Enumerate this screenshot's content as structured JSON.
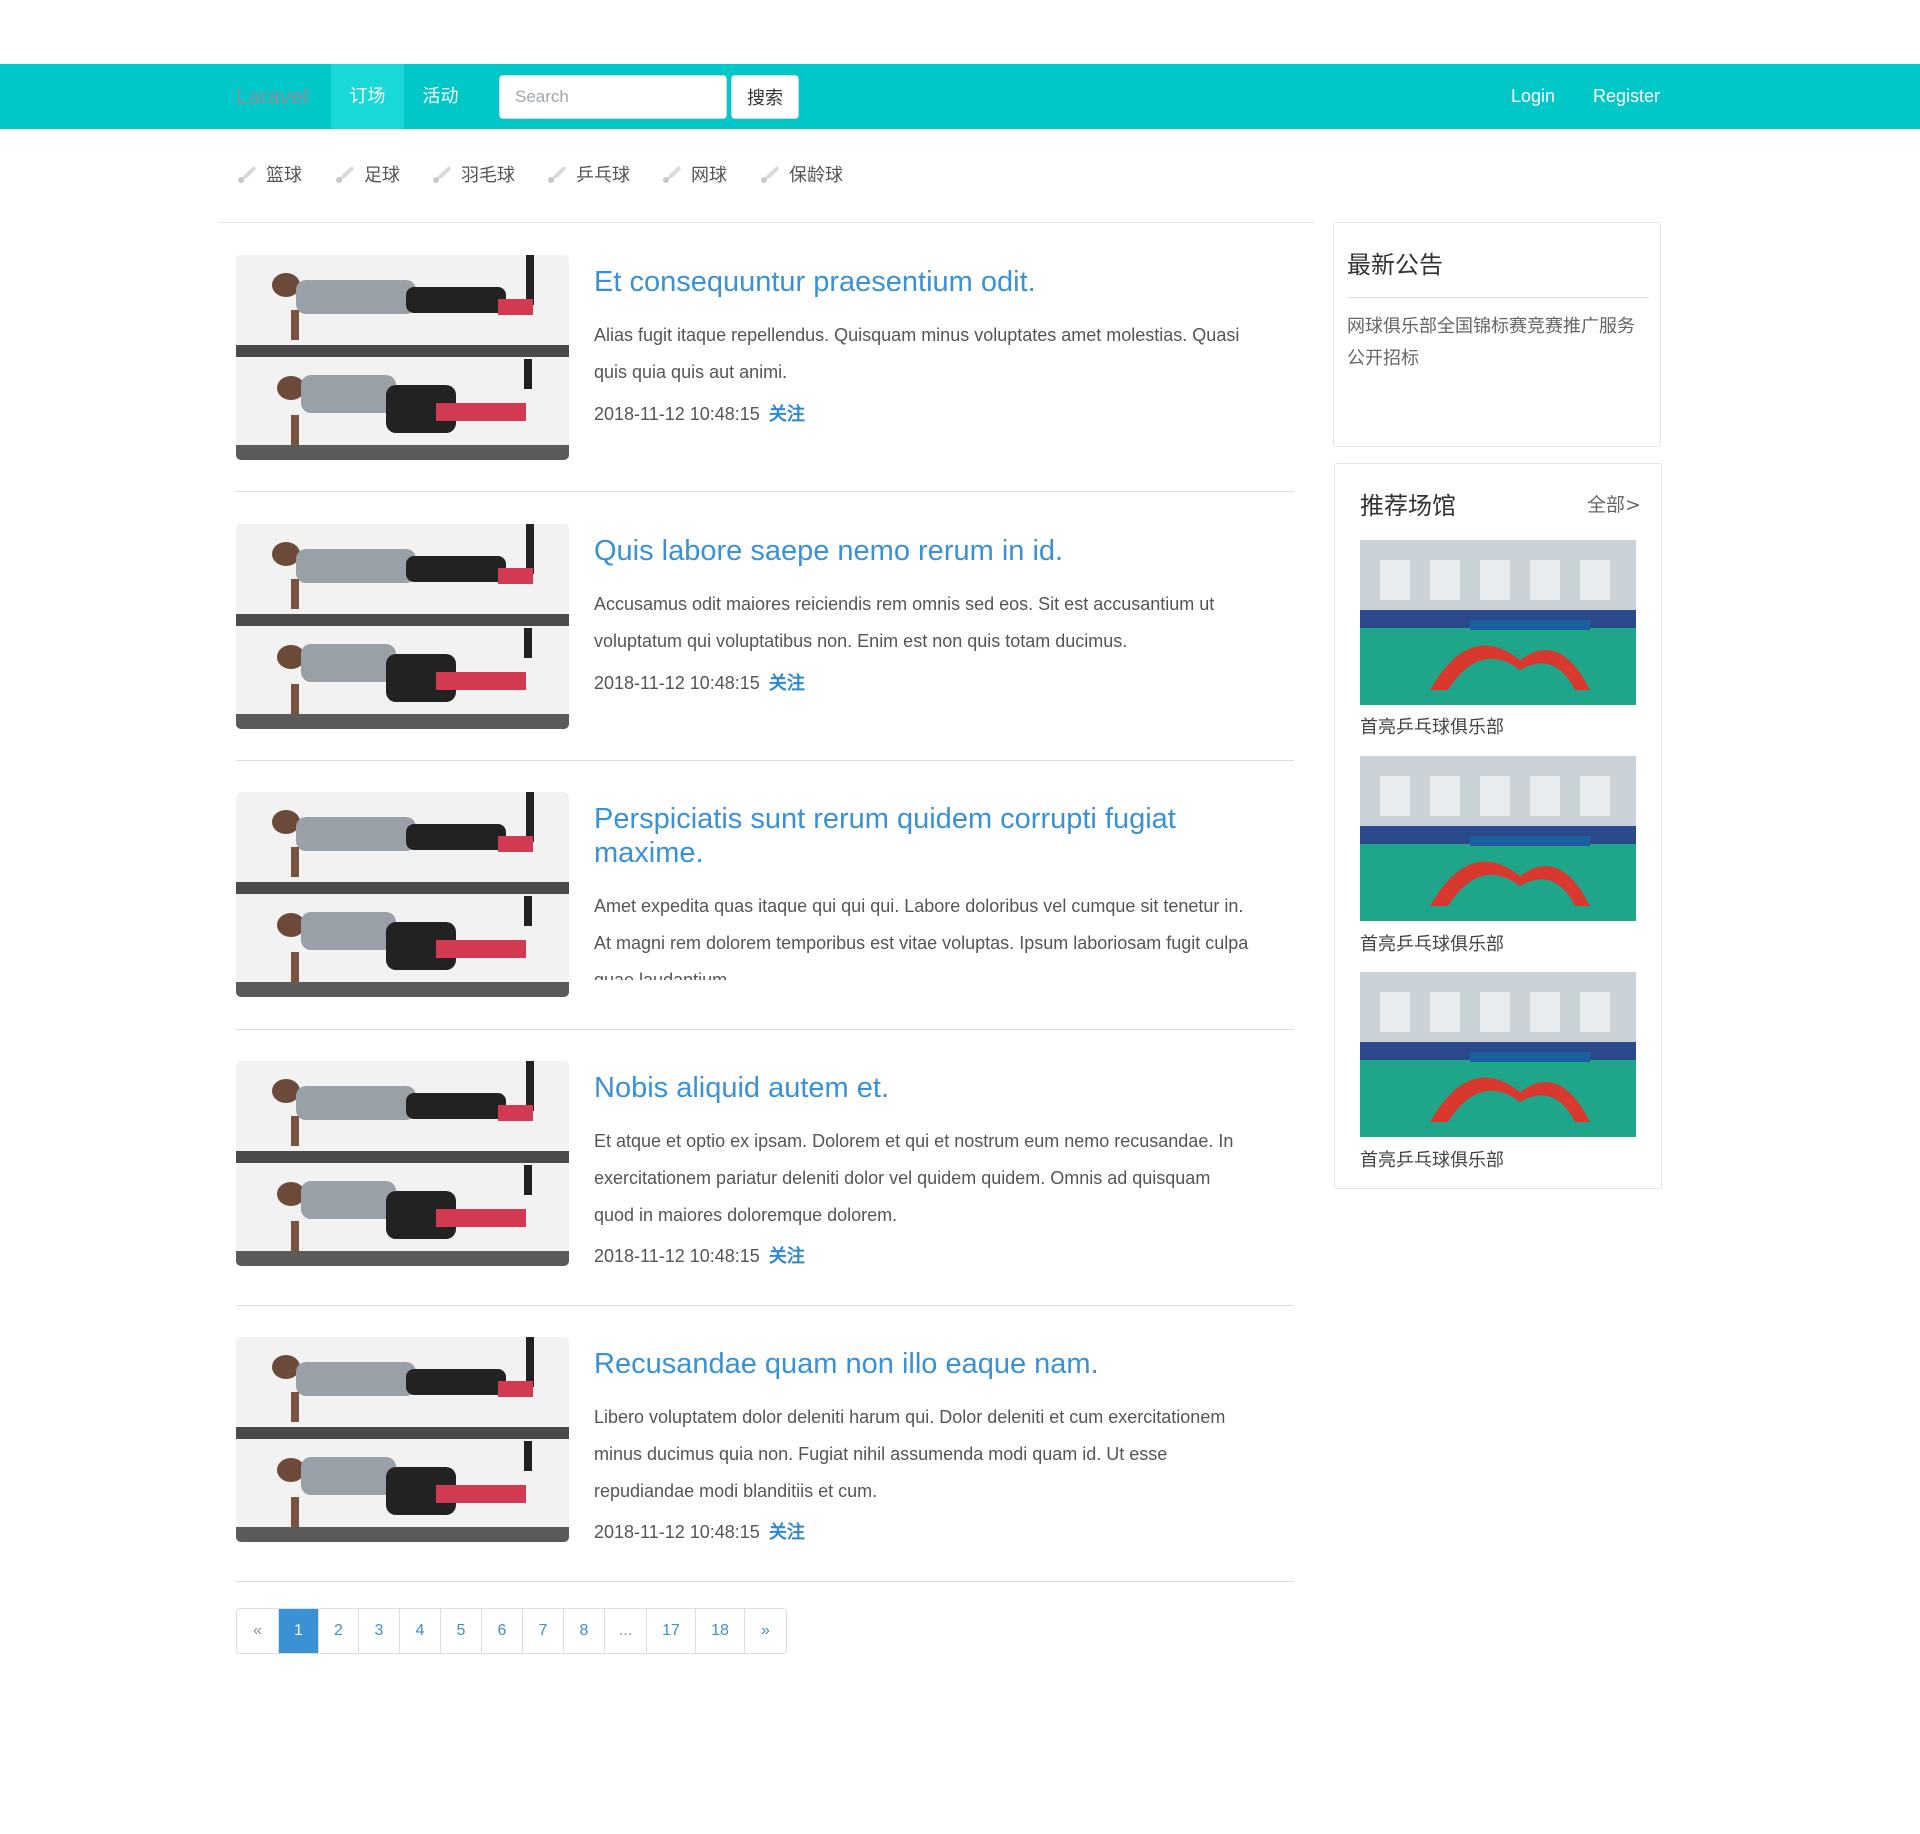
{
  "nav": {
    "brand": "Laravel",
    "links": [
      "订场",
      "活动"
    ],
    "search_placeholder": "Search",
    "search_button": "搜索",
    "login": "Login",
    "register": "Register"
  },
  "categories": [
    "篮球",
    "足球",
    "羽毛球",
    "乒乓球",
    "网球",
    "保龄球"
  ],
  "articles": [
    {
      "title": "Et consequuntur praesentium odit.",
      "body": "Alias fugit itaque repellendus. Quisquam minus voluptates amet molestias. Quasi quis quia quis aut animi.",
      "date": "2018-11-12 10:48:15",
      "follow": "关注"
    },
    {
      "title": "Quis labore saepe nemo rerum in id.",
      "body": "Accusamus odit maiores reiciendis rem omnis sed eos. Sit est accusantium ut voluptatum qui voluptatibus non. Enim est non quis totam ducimus.",
      "date": "2018-11-12 10:48:15",
      "follow": "关注"
    },
    {
      "title": "Perspiciatis sunt rerum quidem corrupti fugiat maxime.",
      "body": "Amet expedita quas itaque qui qui qui. Labore doloribus vel cumque sit tenetur in. At magni rem dolorem temporibus est vitae voluptas. Ipsum laboriosam fugit culpa quae laudantium."
    },
    {
      "title": "Nobis aliquid autem et.",
      "body": "Et atque et optio ex ipsam. Dolorem et qui et nostrum eum nemo recusandae. In exercitationem pariatur deleniti dolor vel quidem quidem. Omnis ad quisquam quod in maiores doloremque dolorem.",
      "date": "2018-11-12 10:48:15",
      "follow": "关注"
    },
    {
      "title": "Recusandae quam non illo eaque nam.",
      "body": "Libero voluptatem dolor deleniti harum qui. Dolor deleniti et cum exercitationem minus ducimus quia non. Fugiat nihil assumenda modi quam id. Ut esse repudiandae modi blanditiis et cum.",
      "date": "2018-11-12 10:48:15",
      "follow": "关注"
    }
  ],
  "pagination": {
    "prev": "«",
    "pages": [
      "1",
      "2",
      "3",
      "4",
      "5",
      "6",
      "7",
      "8",
      "...",
      "17",
      "18"
    ],
    "next": "»",
    "current": "1"
  },
  "notice": {
    "title": "最新公告",
    "text": "网球俱乐部全国锦标赛竞赛推广服务公开招标"
  },
  "venues": {
    "title": "推荐场馆",
    "all_link": "全部>",
    "items": [
      {
        "name": "首亮乒乓球俱乐部"
      },
      {
        "name": "首亮乒乓球俱乐部"
      },
      {
        "name": "首亮乒乓球俱乐部"
      }
    ]
  },
  "colors": {
    "navbar": "#00c8c8",
    "link": "#3a91d4",
    "follow": "#2d89d0"
  }
}
